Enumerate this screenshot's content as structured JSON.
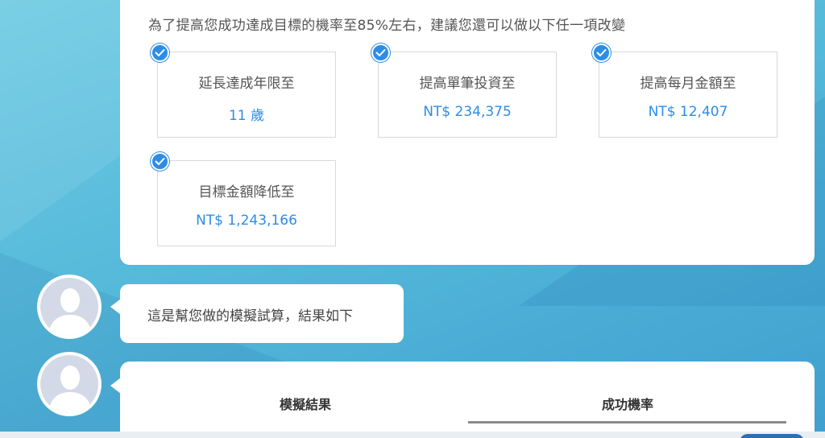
{
  "intro_text": "為了提高您成功達成目標的機率至85%左右，建議您還可以做以下任一項改變",
  "options": [
    {
      "title": "延長達成年限至",
      "value": "11 歲",
      "checked": true
    },
    {
      "title": "提高單筆投資至",
      "value": "NT$ 234,375",
      "checked": true
    },
    {
      "title": "提高每月金額至",
      "value": "NT$ 12,407",
      "checked": true
    },
    {
      "title": "目標金額降低至",
      "value": "NT$ 1,243,166",
      "checked": true
    }
  ],
  "bubble_text": "這是幫您做的模擬試算，結果如下",
  "tabs": [
    {
      "label": "模擬結果",
      "active": false
    },
    {
      "label": "成功機率",
      "active": true
    }
  ],
  "colors": {
    "accent": "#2d8de6",
    "background": "#55b9da"
  }
}
